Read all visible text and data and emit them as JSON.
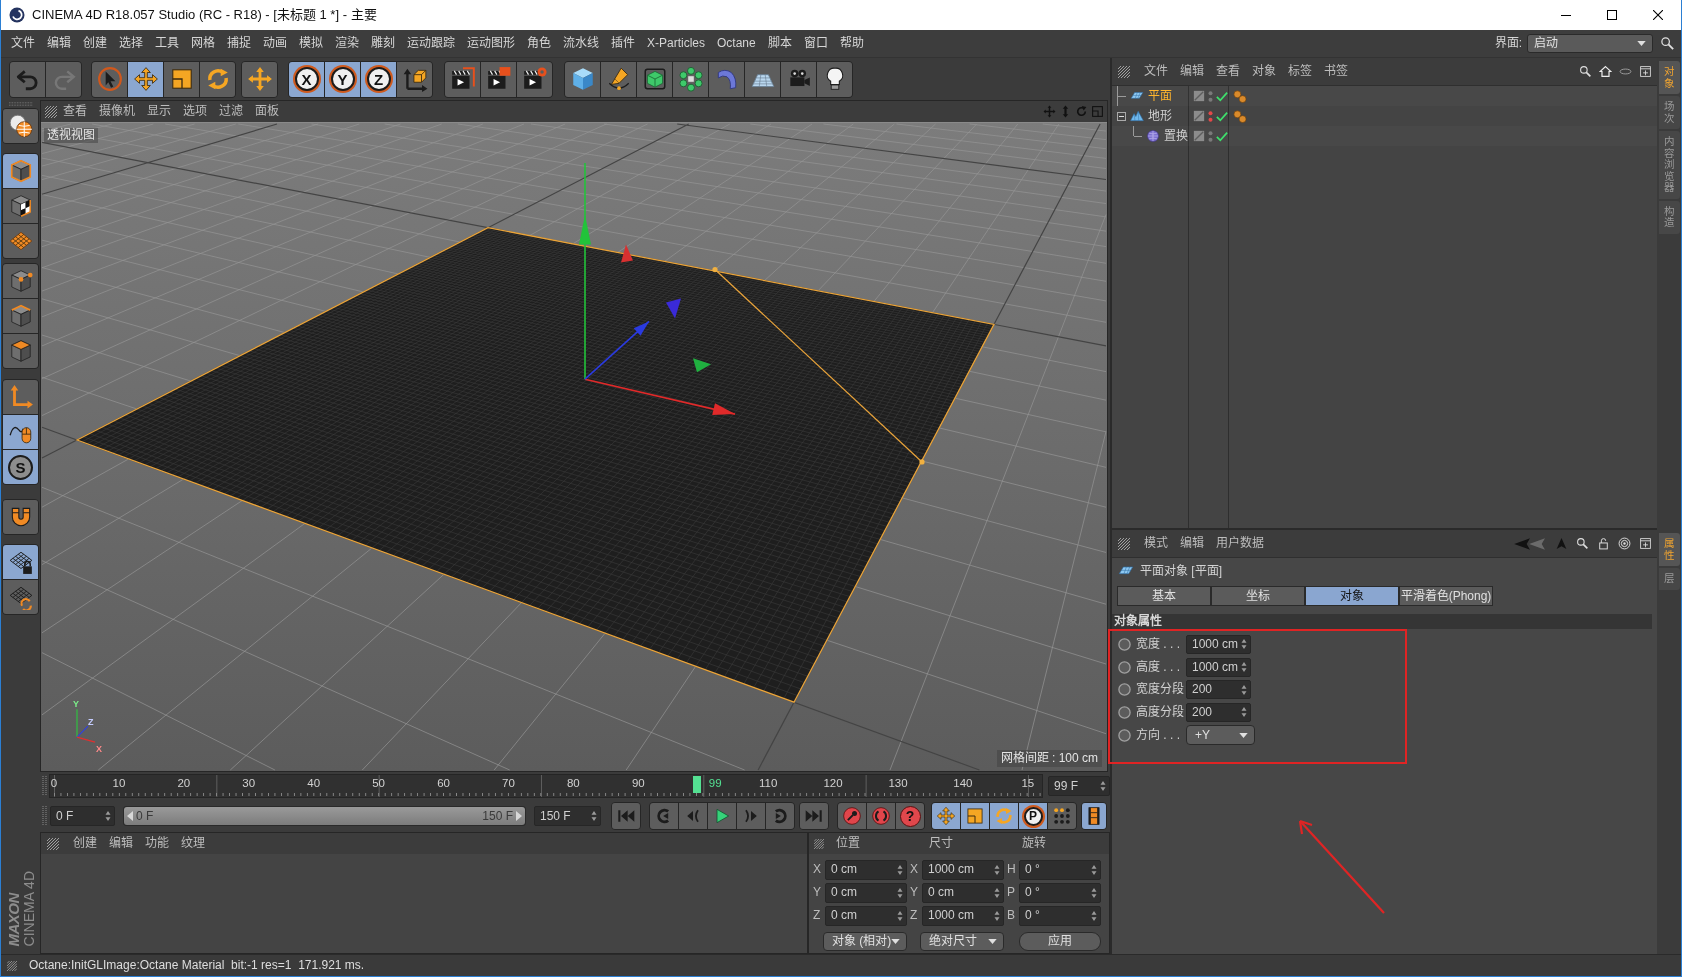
{
  "window": {
    "title": "CINEMA 4D R18.057 Studio (RC - R18) - [未标题 1 *] - 主要"
  },
  "menu_bar": {
    "items": [
      "文件",
      "编辑",
      "创建",
      "选择",
      "工具",
      "网格",
      "捕捉",
      "动画",
      "模拟",
      "渲染",
      "雕刻",
      "运动跟踪",
      "运动图形",
      "角色",
      "流水线",
      "插件",
      "X-Particles",
      "Octane",
      "脚本",
      "窗口",
      "帮助"
    ],
    "layout_label": "界面:",
    "layout_value": "启动"
  },
  "toolbar": {
    "groups": [
      {
        "buttons": [
          {
            "active": false,
            "disabled": false
          },
          {
            "active": false,
            "disabled": true
          }
        ]
      },
      {
        "buttons": [
          {
            "active": false
          },
          {
            "active": true
          },
          {
            "active": false
          },
          {
            "active": false
          }
        ]
      },
      {
        "buttons": [
          {
            "active": false
          }
        ]
      },
      {
        "buttons": [
          {
            "active": true,
            "label": "X"
          },
          {
            "active": true,
            "label": "Y"
          },
          {
            "active": true,
            "label": "Z"
          },
          {
            "active": false
          }
        ]
      },
      {
        "buttons": [
          {
            "active": false
          },
          {
            "active": false
          },
          {
            "active": false
          }
        ]
      },
      {
        "buttons": [
          {
            "active": false
          },
          {
            "active": false
          },
          {
            "active": false
          },
          {
            "active": false
          },
          {
            "active": false
          },
          {
            "active": false
          },
          {
            "active": false
          },
          {
            "active": false
          }
        ]
      }
    ]
  },
  "mode_toolbar": {
    "groups": [
      {
        "buttons": [
          {
            "active": false
          }
        ]
      },
      {
        "buttons": [
          {
            "active": true
          },
          {
            "active": false
          },
          {
            "active": false
          }
        ]
      },
      {
        "buttons": [
          {
            "active": false
          },
          {
            "active": false
          },
          {
            "active": false
          }
        ]
      },
      {
        "buttons": [
          {
            "active": false
          },
          {
            "active": true
          },
          {
            "active": true,
            "label": "S"
          }
        ]
      },
      {
        "buttons": [
          {
            "active": false
          }
        ]
      },
      {
        "buttons": [
          {
            "active": true
          },
          {
            "active": false
          }
        ]
      }
    ]
  },
  "logo": {
    "brand": "MAXON",
    "product": "CINEMA 4D"
  },
  "viewport": {
    "menu": [
      "查看",
      "摄像机",
      "显示",
      "选项",
      "过滤",
      "面板"
    ],
    "view_name": "透视视图",
    "grid_spacing": "网格间距 : 100 cm",
    "axis_labels": [
      "Y",
      "Z",
      "X"
    ]
  },
  "timeline": {
    "ticks_before": [
      "0",
      "10",
      "20",
      "30",
      "40",
      "50",
      "60",
      "70",
      "80",
      "90"
    ],
    "playhead": {
      "label": "99",
      "level": 0.66
    },
    "ticks_after": [
      "110",
      "120",
      "130",
      "140",
      "15"
    ],
    "current_frame": "99 F"
  },
  "transport": {
    "start_field": "0 F",
    "range": {
      "start": "0 F",
      "end": "150 F",
      "level": 1
    },
    "end_field": "150 F",
    "button_groups": [
      {
        "buttons": [
          {
            "active": false
          }
        ]
      },
      {
        "buttons": [
          {
            "active": false
          },
          {
            "active": false
          },
          {
            "active": false
          },
          {
            "active": false
          },
          {
            "active": false
          }
        ]
      },
      {
        "buttons": [
          {
            "active": false
          }
        ]
      },
      {
        "buttons": [
          {
            "active": false
          },
          {
            "active": false
          },
          {
            "active": false,
            "label": "?"
          }
        ]
      },
      {
        "buttons": [
          {
            "active": true
          },
          {
            "active": true
          },
          {
            "active": true
          },
          {
            "active": true,
            "label": "P"
          },
          {
            "active": false
          }
        ]
      },
      {
        "buttons": [
          {
            "active": true
          }
        ]
      }
    ]
  },
  "material_manager": {
    "menu": [
      "创建",
      "编辑",
      "功能",
      "纹理"
    ]
  },
  "coordinates": {
    "columns": [
      {
        "title": "位置",
        "rows": [
          {
            "axis": "X",
            "value": "0 cm"
          },
          {
            "axis": "Y",
            "value": "0 cm"
          },
          {
            "axis": "Z",
            "value": "0 cm"
          }
        ],
        "footer": {
          "kind": "dropdown",
          "text": "对象 (相对)"
        }
      },
      {
        "title": "尺寸",
        "rows": [
          {
            "axis": "X",
            "value": "1000 cm"
          },
          {
            "axis": "Y",
            "value": "0 cm"
          },
          {
            "axis": "Z",
            "value": "1000 cm"
          }
        ],
        "footer": {
          "kind": "dropdown",
          "text": "绝对尺寸"
        }
      },
      {
        "title": "旋转",
        "rows": [
          {
            "axis": "H",
            "value": "0 °"
          },
          {
            "axis": "P",
            "value": "0 °"
          },
          {
            "axis": "B",
            "value": "0 °"
          }
        ],
        "footer": {
          "kind": "button",
          "text": "应用"
        }
      }
    ]
  },
  "status_bar": {
    "text": "Octane:InitGLImage:Octane Material  bit:-1 res=1  171.921 ms."
  },
  "object_manager": {
    "menu": [
      "文件",
      "编辑",
      "查看",
      "对象",
      "标签",
      "书签"
    ],
    "objects": [
      {
        "kind": "plane",
        "name": "平面",
        "selected": true,
        "hidden": false,
        "enabled": true,
        "phong_tag": true
      },
      {
        "kind": "landscape",
        "name": "地形",
        "selected": false,
        "expanded": true,
        "hidden": true,
        "enabled": true,
        "phong_tag": true,
        "children": [
          {
            "kind": "displacer",
            "name": "置换",
            "selected": false,
            "hidden": false,
            "enabled": true,
            "phong_tag": false
          }
        ]
      }
    ]
  },
  "attributes": {
    "menu": [
      "模式",
      "编辑",
      "用户数据"
    ],
    "title": "平面对象 [平面]",
    "tabs": [
      {
        "label": "基本",
        "selected": false
      },
      {
        "label": "坐标",
        "selected": false
      },
      {
        "label": "对象",
        "selected": true
      },
      {
        "label": "平滑着色(Phong)",
        "selected": false
      }
    ],
    "section": "对象属性",
    "fields": [
      {
        "kind": "number",
        "label": "宽度 . . .",
        "value": "1000 cm"
      },
      {
        "kind": "number",
        "label": "高度 . . .",
        "value": "1000 cm"
      },
      {
        "kind": "number",
        "label": "宽度分段",
        "value": "200"
      },
      {
        "kind": "number",
        "label": "高度分段",
        "value": "200"
      },
      {
        "kind": "dropdown",
        "label": "方向 . . .",
        "value": "+Y"
      }
    ]
  },
  "side_tabs": {
    "upper": [
      {
        "label": "对象",
        "selected": true
      },
      {
        "label": "场次",
        "selected": false
      },
      {
        "label": "内容浏览器",
        "selected": false
      },
      {
        "label": "构造",
        "selected": false
      }
    ],
    "lower": [
      {
        "label": "属性",
        "selected": true
      },
      {
        "label": "层",
        "selected": false
      }
    ]
  }
}
